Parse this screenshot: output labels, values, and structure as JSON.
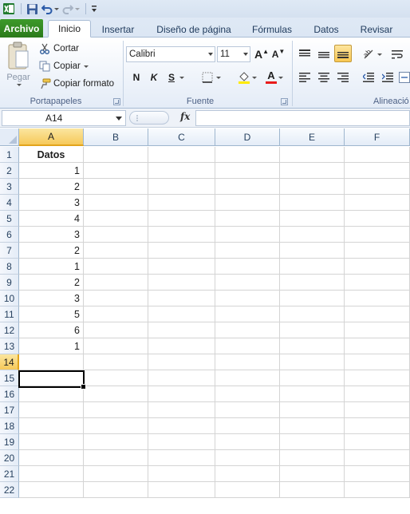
{
  "app": {
    "icon": "excel-icon"
  },
  "quick_access": {
    "items": [
      "excel-icon",
      "save-icon",
      "undo-icon",
      "redo-icon",
      "customize-icon"
    ]
  },
  "tabs": {
    "file": "Archivo",
    "items": [
      "Inicio",
      "Insertar",
      "Diseño de página",
      "Fórmulas",
      "Datos",
      "Revisar"
    ],
    "active": "Inicio"
  },
  "ribbon": {
    "clipboard": {
      "paste_label": "Pegar",
      "cut_label": "Cortar",
      "copy_label": "Copiar",
      "format_painter_label": "Copiar formato",
      "group_label": "Portapapeles"
    },
    "font": {
      "font_name": "Calibri",
      "font_size": "11",
      "grow_label": "A",
      "shrink_label": "A",
      "bold_label": "N",
      "italic_label": "K",
      "underline_label": "S",
      "font_color_label": "A",
      "group_label": "Fuente",
      "highlight_color": "#ffeb00",
      "font_color": "#e81b1b"
    },
    "alignment": {
      "group_label": "Alineació"
    }
  },
  "formula_bar": {
    "name_box": "A14",
    "fx_label": "fx",
    "formula": ""
  },
  "sheet": {
    "columns": [
      "A",
      "B",
      "C",
      "D",
      "E",
      "F"
    ],
    "selected_column": "A",
    "rows": [
      "1",
      "2",
      "3",
      "4",
      "5",
      "6",
      "7",
      "8",
      "9",
      "10",
      "11",
      "12",
      "13",
      "14",
      "15",
      "16",
      "17",
      "18",
      "19",
      "20",
      "21",
      "22"
    ],
    "selected_row": "14",
    "column_a": [
      "Datos",
      "1",
      "2",
      "3",
      "4",
      "3",
      "2",
      "1",
      "2",
      "3",
      "5",
      "6",
      "1"
    ],
    "active_cell": "A14"
  }
}
